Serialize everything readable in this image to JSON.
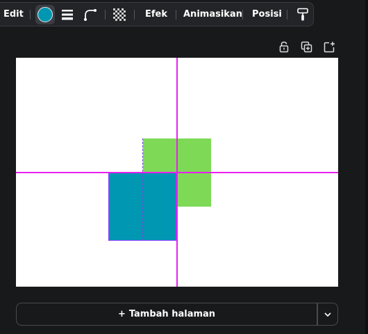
{
  "toolbar": {
    "edit_label": "Edit",
    "effects_label": "Efek",
    "animate_label": "Animasikan",
    "position_label": "Posisi",
    "icons": [
      "fill-color-icon",
      "line-weight-icon",
      "corner-rounding-icon",
      "transparency-icon",
      "copy-style-icon"
    ]
  },
  "page_actions": {
    "icons": [
      "lock-icon",
      "duplicate-page-icon",
      "add-page-icon"
    ]
  },
  "canvas": {
    "background": "#ffffff",
    "shapes": [
      {
        "name": "green-square",
        "color": "#7ed957"
      },
      {
        "name": "blue-square",
        "color": "#0097b2",
        "selected": true
      }
    ],
    "guide_color": "#e91ef0",
    "selection_color": "#8b3dff"
  },
  "footer": {
    "add_page_plus": "+",
    "add_page_label": "Tambah halaman",
    "dropdown_icon": "chevron-down-icon"
  },
  "colors": {
    "fill": "#0097b2",
    "panel_bg": "#18191b",
    "toolbar_bg": "#232428"
  }
}
